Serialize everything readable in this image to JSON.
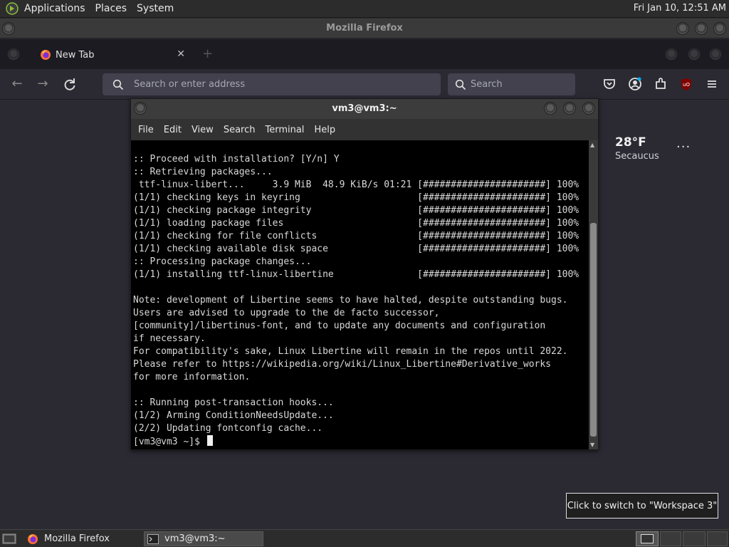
{
  "top_panel": {
    "menus": [
      "Applications",
      "Places",
      "System"
    ],
    "clock": "Fri Jan 10, 12:51 AM"
  },
  "firefox": {
    "window_title": "Mozilla Firefox",
    "tab": {
      "label": "New Tab",
      "close": "✕"
    },
    "urlbar": {
      "placeholder": "Search or enter address"
    },
    "searchbar": {
      "placeholder": "Search"
    },
    "weather": {
      "temp": "28°F",
      "city": "Secaucus",
      "more": "···"
    }
  },
  "terminal": {
    "title": "vm3@vm3:~",
    "menus": [
      "File",
      "Edit",
      "View",
      "Search",
      "Terminal",
      "Help"
    ],
    "lines": [
      ":: Proceed with installation? [Y/n] Y",
      ":: Retrieving packages...",
      " ttf-linux-libert...     3.9 MiB  48.9 KiB/s 01:21 [######################] 100%",
      "(1/1) checking keys in keyring                     [######################] 100%",
      "(1/1) checking package integrity                   [######################] 100%",
      "(1/1) loading package files                        [######################] 100%",
      "(1/1) checking for file conflicts                  [######################] 100%",
      "(1/1) checking available disk space                [######################] 100%",
      ":: Processing package changes...",
      "(1/1) installing ttf-linux-libertine               [######################] 100%",
      "",
      "Note: development of Libertine seems to have halted, despite outstanding bugs.",
      "Users are advised to upgrade to the de facto successor,",
      "[community]/libertinus-font, and to update any documents and configuration",
      "if necessary.",
      "For compatibility's sake, Linux Libertine will remain in the repos until 2022.",
      "Please refer to https://wikipedia.org/wiki/Linux_Libertine#Derivative_works",
      "for more information.",
      "",
      ":: Running post-transaction hooks...",
      "(1/2) Arming ConditionNeedsUpdate...",
      "(2/2) Updating fontconfig cache..."
    ],
    "prompt": "[vm3@vm3 ~]$ "
  },
  "tooltip": "Click to switch to \"Workspace 3\"",
  "taskbar": {
    "tasks": [
      {
        "label": "Mozilla Firefox"
      },
      {
        "label": "vm3@vm3:~"
      }
    ]
  }
}
